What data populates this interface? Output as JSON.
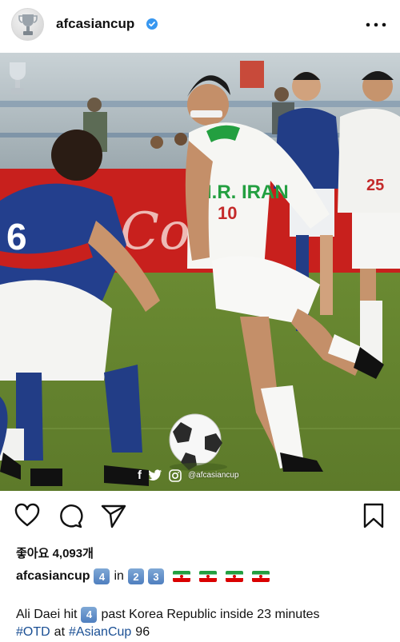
{
  "header": {
    "username": "afcasiancup",
    "verified": true,
    "avatar_icon": "trophy-icon",
    "more_icon": "more-dots-icon"
  },
  "photo": {
    "watermark_handle": "@afcasiancup",
    "watermark_icons": [
      "facebook-icon",
      "twitter-icon",
      "instagram-icon"
    ],
    "shirt_text": "I.R. IRAN",
    "player_number": "10",
    "banner_text": "Coca"
  },
  "actions": {
    "like_icon": "heart-icon",
    "comment_icon": "comment-icon",
    "share_icon": "send-icon",
    "save_icon": "bookmark-icon"
  },
  "likes": {
    "text": "좋아요 4,093개"
  },
  "caption": {
    "username": "afcasiancup",
    "keycap_1": "4",
    "word_in": "in",
    "keycap_2": "2",
    "keycap_3": "3",
    "flag_count": 4
  },
  "body": {
    "line1_prefix": "Ali Daei hit",
    "line1_keycap": "4",
    "line1_suffix": "past Korea Republic inside 23 minutes",
    "hashtag_otd": "#OTD",
    "word_at": "at",
    "hashtag_asiancup": "#AsianCup",
    "year": "96"
  },
  "colors": {
    "hashtag": "#1a4f94",
    "verified": "#3897f0",
    "iran_green": "#239f40",
    "iran_red": "#da0000"
  }
}
